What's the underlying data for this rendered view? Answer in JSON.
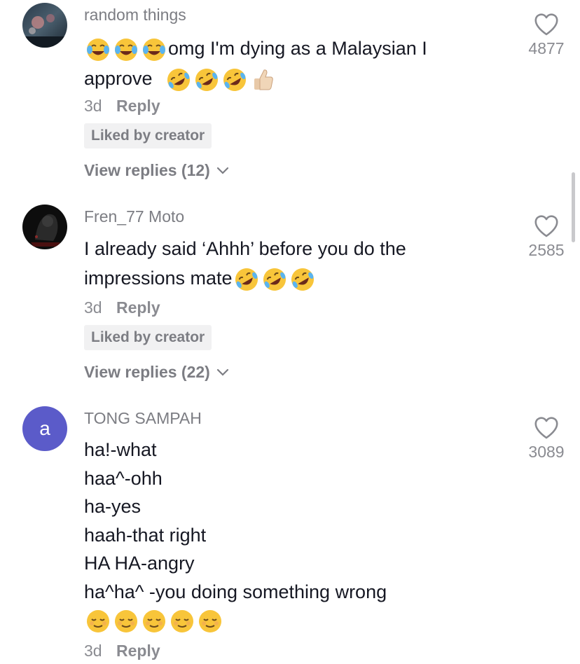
{
  "comments": [
    {
      "username": "random things",
      "text_lines": [
        "omg I'm dying as a Malaysian I",
        "approve"
      ],
      "lead_emojis": [
        "joy",
        "joy",
        "joy"
      ],
      "trail_emojis": [
        "rofl",
        "rofl",
        "rofl",
        "thumbs-up"
      ],
      "time": "3d",
      "reply_label": "Reply",
      "liked_label": "Liked by creator",
      "view_replies": "View replies (12)",
      "likes": "4877"
    },
    {
      "username": "Fren_77 Moto",
      "text_lines": [
        "I already said ‘Ahhh’ before you do the",
        "impressions mate"
      ],
      "trail_emojis": [
        "rofl",
        "rofl",
        "rofl"
      ],
      "time": "3d",
      "reply_label": "Reply",
      "liked_label": "Liked by creator",
      "view_replies": "View replies (22)",
      "likes": "2585"
    },
    {
      "username": "TONG SAMPAH",
      "avatar_letter": "a",
      "text_lines": [
        "ha!-what",
        "haa^-ohh",
        "ha-yes",
        "haah-that right",
        "HA HA-angry",
        "ha^ha^ -you doing something wrong"
      ],
      "trail_emojis": [
        "relieved",
        "relieved",
        "relieved",
        "relieved",
        "relieved"
      ],
      "time": "3d",
      "reply_label": "Reply",
      "likes": "3089"
    }
  ],
  "colors": {
    "avatar_letter_bg": "#5b5bc9",
    "muted_text": "#8a8b91",
    "badge_bg": "#f1f1f2"
  }
}
